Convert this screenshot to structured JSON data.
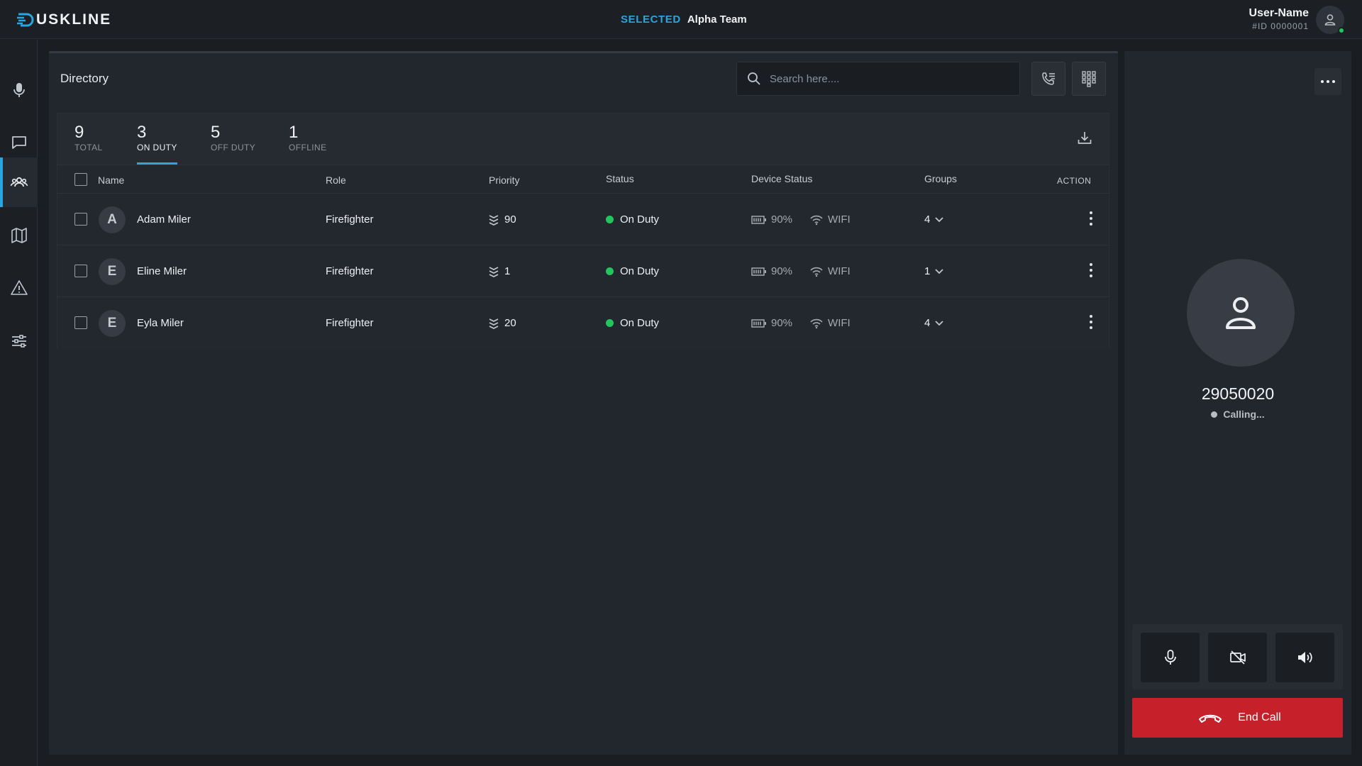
{
  "app": {
    "logo_text": "USKLINE",
    "selected_label": "SELECTED",
    "selected_team": "Alpha Team",
    "user_name": "User-Name",
    "user_id": "#ID 0000001",
    "accent_color": "#2aa5e0",
    "online_color": "#22c55e"
  },
  "sidebar": {
    "items": [
      {
        "icon": "microphone-icon"
      },
      {
        "icon": "chat-icon"
      },
      {
        "icon": "people-icon",
        "active": true
      },
      {
        "icon": "map-icon"
      },
      {
        "icon": "warning-icon"
      },
      {
        "icon": "sliders-icon"
      }
    ]
  },
  "directory": {
    "title": "Directory",
    "search_placeholder": "Search here....",
    "stats": [
      {
        "value": "9",
        "label": "TOTAL"
      },
      {
        "value": "3",
        "label": "ON DUTY",
        "active": true
      },
      {
        "value": "5",
        "label": "OFF DUTY"
      },
      {
        "value": "1",
        "label": "OFFLINE"
      }
    ],
    "columns": {
      "name": "Name",
      "role": "Role",
      "priority": "Priority",
      "status": "Status",
      "device_status": "Device Status",
      "groups": "Groups",
      "action": "ACTION"
    },
    "rows": [
      {
        "initial": "A",
        "name": "Adam Miler",
        "role": "Firefighter",
        "priority": "90",
        "status": "On Duty",
        "battery": "90%",
        "network": "WIFI",
        "groups": "4"
      },
      {
        "initial": "E",
        "name": "Eline Miler",
        "role": "Firefighter",
        "priority": "1",
        "status": "On Duty",
        "battery": "90%",
        "network": "WIFI",
        "groups": "1"
      },
      {
        "initial": "E",
        "name": "Eyla Miler",
        "role": "Firefighter",
        "priority": "20",
        "status": "On Duty",
        "battery": "90%",
        "network": "WIFI",
        "groups": "4"
      }
    ]
  },
  "call": {
    "number": "29050020",
    "status": "Calling...",
    "end_label": "End Call",
    "end_color": "#c6212b"
  }
}
